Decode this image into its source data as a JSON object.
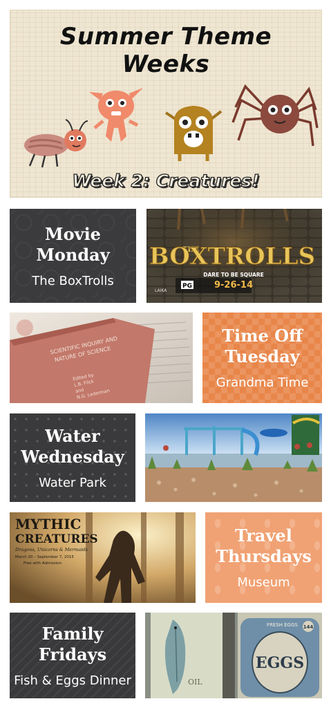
{
  "header": {
    "title_line1": "Summer Theme",
    "title_line2": "Weeks",
    "week_label": "Week 2: Creatures!"
  },
  "days": [
    {
      "title_line1": "Movie",
      "title_line2": "Monday",
      "subtitle": "The BoxTrolls"
    },
    {
      "title_line1": "Time Off",
      "title_line2": "Tuesday",
      "subtitle": "Grandma Time"
    },
    {
      "title_line1": "Water",
      "title_line2": "Wednesday",
      "subtitle": "Water Park"
    },
    {
      "title_line1": "Travel",
      "title_line2": "Thursdays",
      "subtitle": "Museum"
    },
    {
      "title_line1": "Family",
      "title_line2": "Fridays",
      "subtitle": "Fish & Eggs Dinner"
    }
  ],
  "photos": {
    "boxtrolls": {
      "the": "THE",
      "title": "BOXTROLLS",
      "tagline": "DARE TO BE SQUARE",
      "date": "9-26-14",
      "rating": "PG",
      "studio": "LAIKA"
    },
    "book": {
      "lines": [
        "SCIENTIFIC INQUIRY AND",
        "NATURE OF SCIENCE"
      ],
      "editors": [
        "Edited by",
        "L.B. Flick",
        "and",
        "N.G. Lederman"
      ]
    },
    "waterpark": {},
    "mythic": {
      "title_line1": "MYTHIC",
      "title_line2": "CREATURES",
      "subtitle": "Dragons, Unicorns & Mermaids",
      "dates": "March 20 – September 7, 2015",
      "note": "Free with Admission"
    },
    "fish_eggs": {
      "eggs": "EGGS",
      "fresh_eggs": "FRESH EGGS",
      "oil": "OIL",
      "number": "144"
    }
  },
  "colors": {
    "dark_tile": "#3b3b3d",
    "orange_tile": "#e8864a",
    "light_orange_tile": "#f0a274",
    "header_bg": "#efe6d2"
  }
}
